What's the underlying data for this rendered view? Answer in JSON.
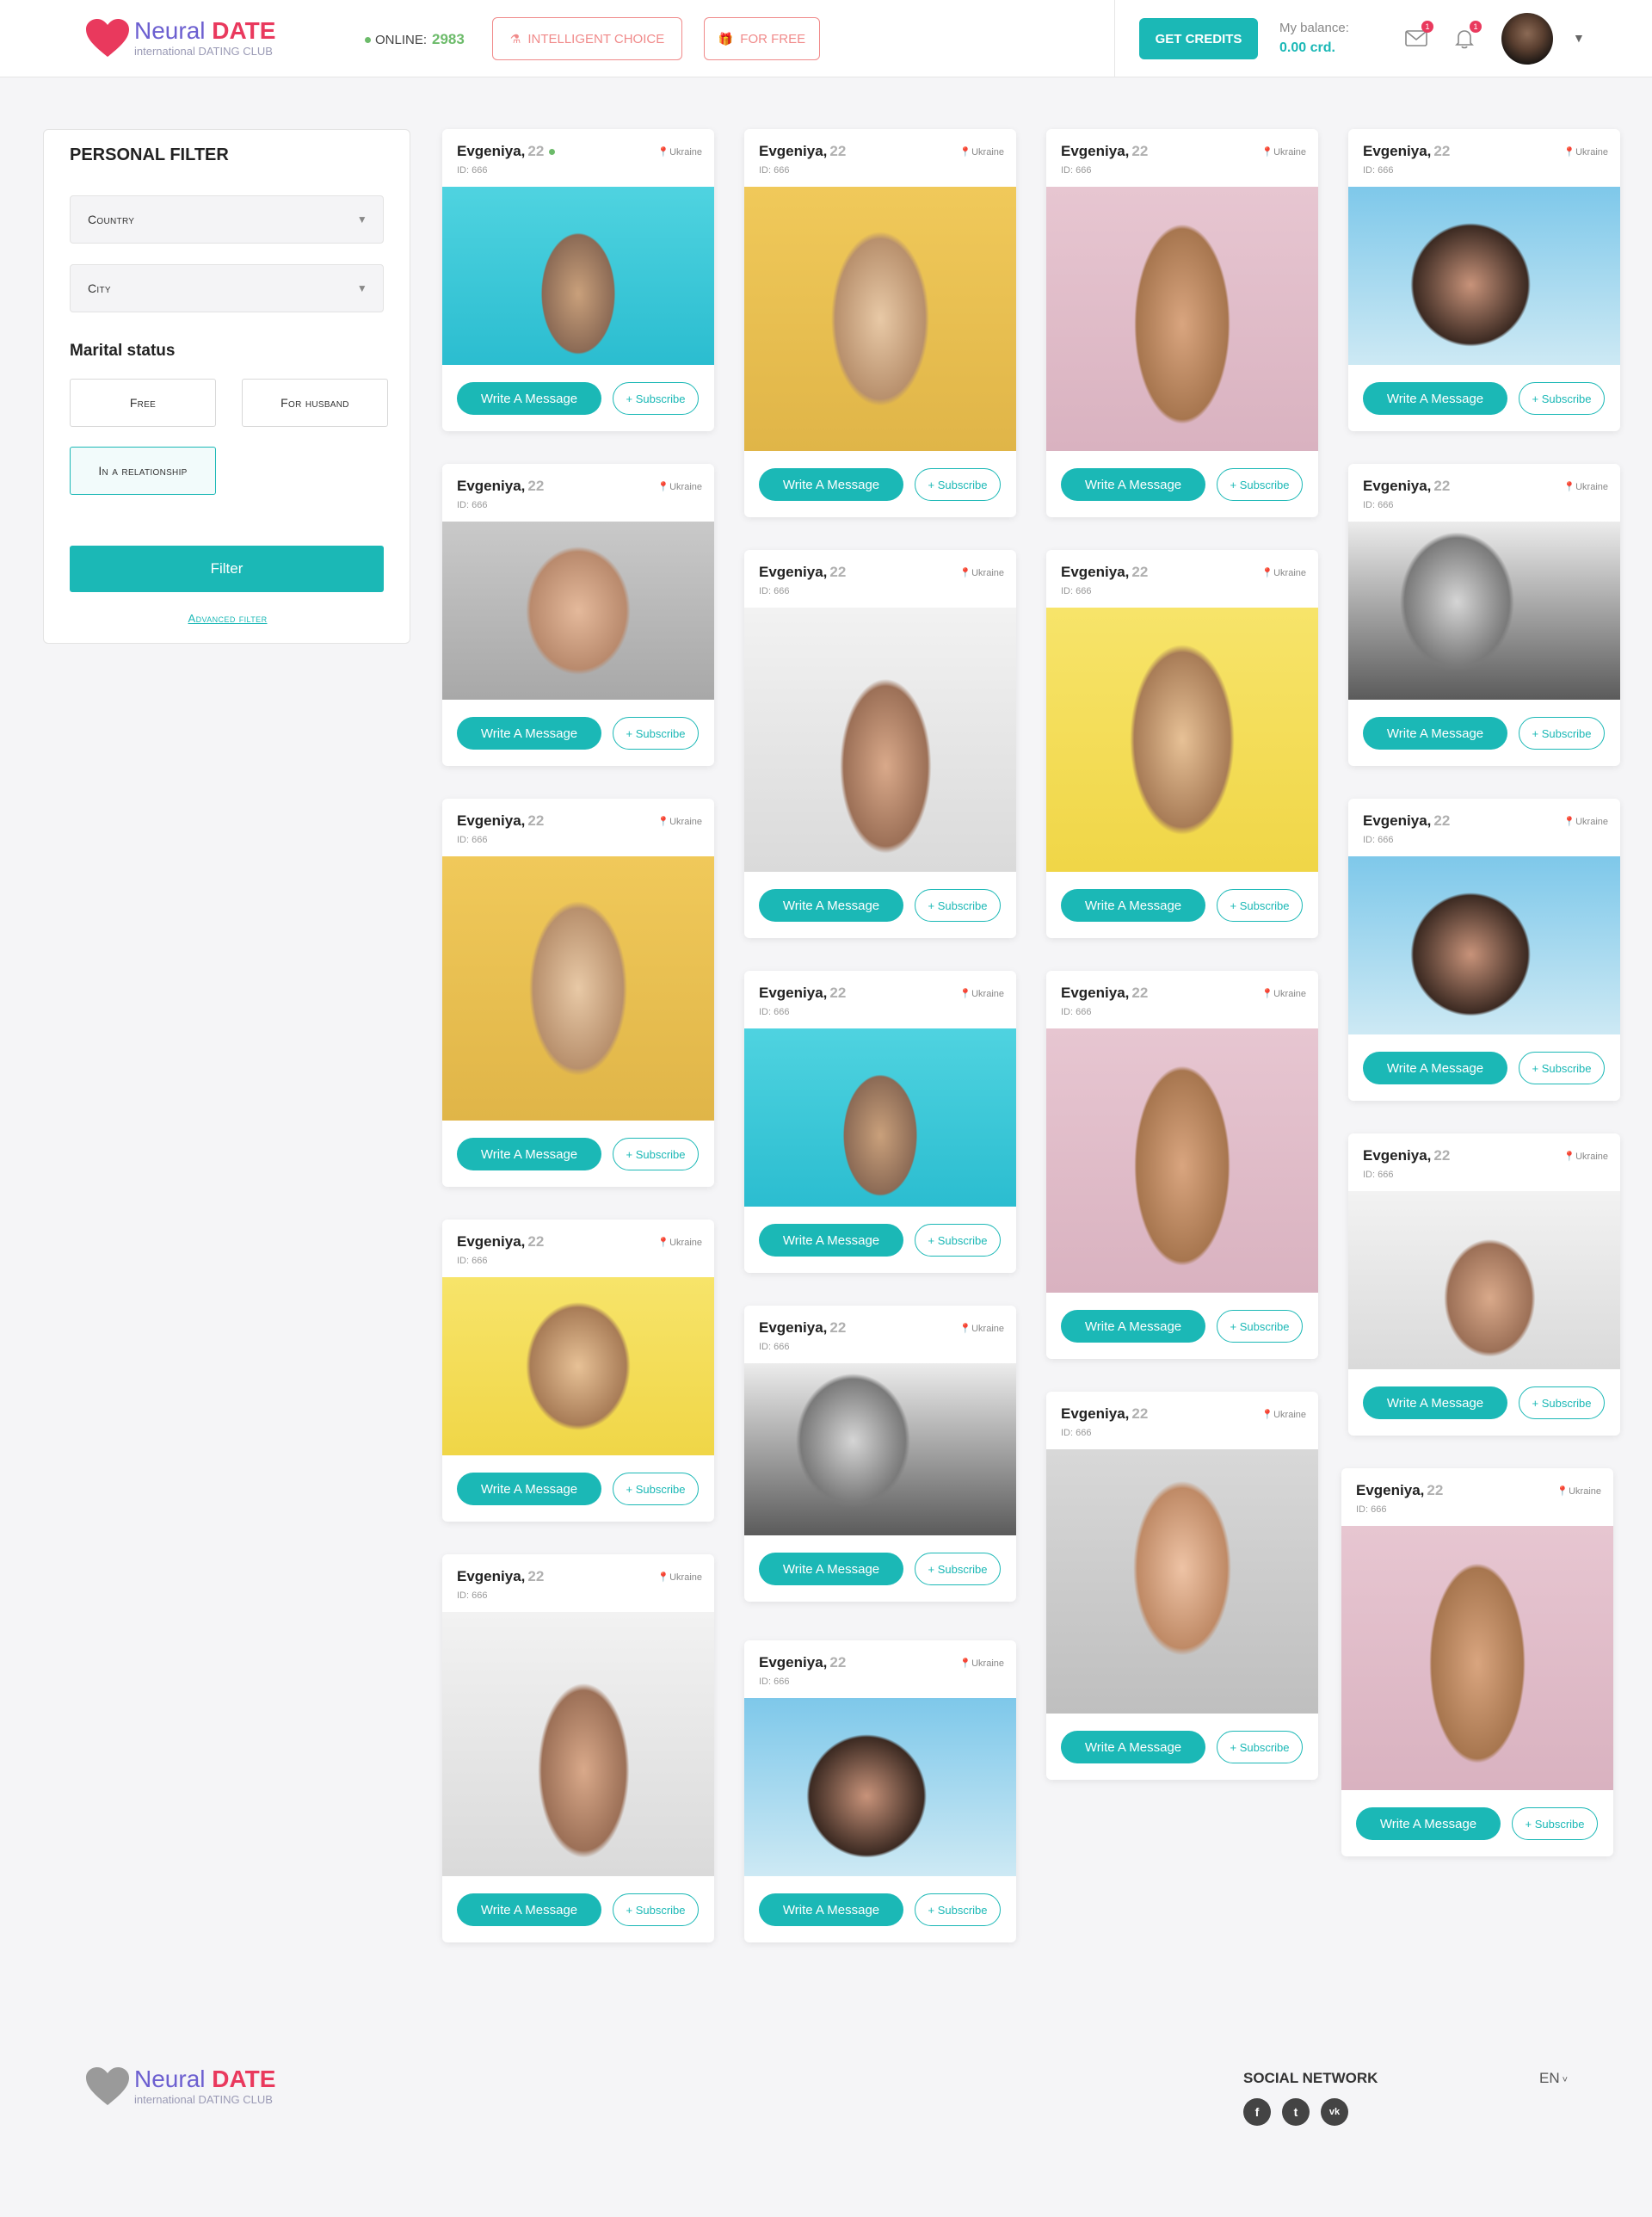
{
  "header": {
    "brand_light": "Neural",
    "brand_bold": "DATE",
    "tagline": "international DATING CLUB",
    "online_label": "ONLINE:",
    "online_count": "2983",
    "intelligent_choice": "INTELLIGENT CHOICE",
    "for_free": "FOR FREE",
    "get_credits": "GET CREDITS",
    "balance_label": "My balance:",
    "balance_value": "0.00 crd.",
    "mail_badge": "1",
    "bell_badge": "1"
  },
  "filter": {
    "title": "PERSONAL FILTER",
    "country": "Country",
    "city": "City",
    "marital_title": "Marital status",
    "opt_free": "Free",
    "opt_husband": "For husband",
    "opt_relationship": "In a relationship",
    "filter_button": "Filter",
    "advanced": "Advanced filter"
  },
  "card_text": {
    "name": "Evgeniya,",
    "age": "22",
    "id": "ID: 666",
    "location": "Ukraine",
    "write": "Write A Message",
    "subscribe": "+ Subscribe"
  },
  "footer": {
    "brand_light": "Neural",
    "brand_bold": "DATE",
    "tagline": "international DATING CLUB",
    "social_heading": "SOCIAL NETWORK",
    "facebook": "f",
    "twitter": "t",
    "vk": "vk",
    "language": "EN"
  },
  "colors": {
    "accent": "#1bb8b6",
    "brand_red": "#e9395d",
    "brand_purple": "#6c5fd0",
    "online_green": "#6cbb6a"
  }
}
